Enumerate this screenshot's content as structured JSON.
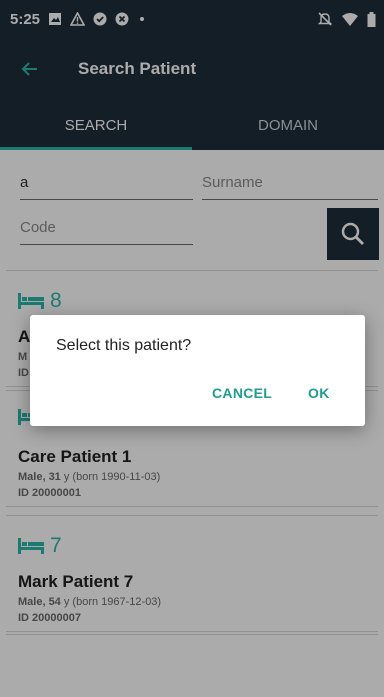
{
  "status_bar": {
    "time": "5:25"
  },
  "app_bar": {
    "title": "Search Patient"
  },
  "tabs": [
    {
      "label": "SEARCH",
      "active": true
    },
    {
      "label": "DOMAIN",
      "active": false
    }
  ],
  "search_form": {
    "name_value": "a",
    "surname_placeholder": "Surname",
    "code_placeholder": "Code"
  },
  "patients": [
    {
      "bed": "8",
      "name": "A",
      "info_prefix": "M",
      "info_rest": "",
      "id": "ID"
    },
    {
      "bed": "",
      "name": "Care Patient 1",
      "info_prefix": "Male, 31",
      "info_rest": " y (born 1990-11-03)",
      "id": "ID 20000001"
    },
    {
      "bed": "7",
      "name": "Mark Patient 7",
      "info_prefix": "Male, 54",
      "info_rest": " y (born 1967-12-03)",
      "id": "ID 20000007"
    }
  ],
  "dialog": {
    "message": "Select this patient?",
    "cancel_label": "CANCEL",
    "ok_label": "OK"
  },
  "colors": {
    "primary": "#1f2d3a",
    "accent": "#2bb8a8"
  }
}
